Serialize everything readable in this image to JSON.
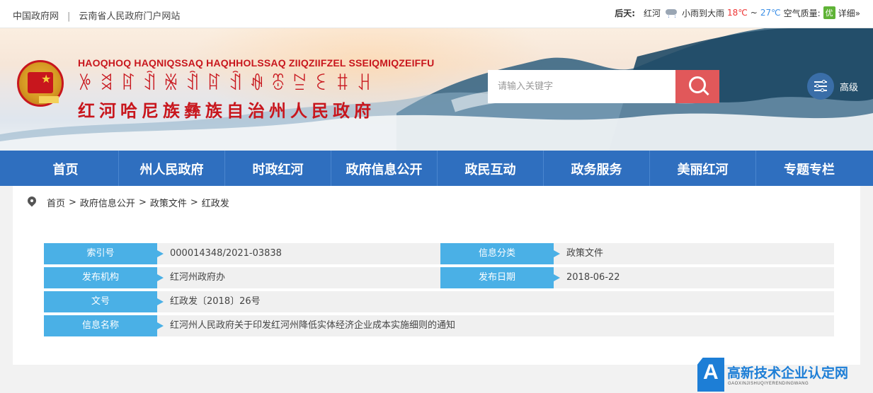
{
  "topbar": {
    "link1": "中国政府网",
    "separator": "|",
    "link2": "云南省人民政府门户网站",
    "weather": {
      "day_label": "后天:",
      "city": "红河",
      "icon": "rain-cloud-icon",
      "condition": "小雨到大雨",
      "temp_high": "18℃",
      "range_sep": "~",
      "temp_low": "27℃",
      "aq_label": "空气质量:",
      "aq_value": "优",
      "details_link": "详细»"
    }
  },
  "header": {
    "title_romanized": "HAOQHOQ HAQNIQSSAQ HAQHHOLSSAQ ZIIQZIIFZEL SSEIQMIQZEIFFU",
    "title_yi": "ꉼꈬꍏꀉꍐꀉꍏꀉꊿꁨꊂꏂꐚꃅ",
    "title_chinese": "红河哈尼族彝族自治州人民政府",
    "emblem_icon": "national-emblem-icon",
    "search_placeholder": "请输入关键字",
    "search_icon": "search-icon",
    "advanced_label": "高级",
    "advanced_icon": "sliders-icon"
  },
  "nav": {
    "items": [
      "首页",
      "州人民政府",
      "时政红河",
      "政府信息公开",
      "政民互动",
      "政务服务",
      "美丽红河",
      "专题专栏"
    ]
  },
  "breadcrumb": {
    "icon": "location-pin-icon",
    "items": [
      "首页",
      "政府信息公开",
      "政策文件",
      "红政发"
    ],
    "separator": ">"
  },
  "meta": {
    "index_label": "索引号",
    "index_value": "000014348/2021-03838",
    "category_label": "信息分类",
    "category_value": "政策文件",
    "publisher_label": "发布机构",
    "publisher_value": "红河州政府办",
    "date_label": "发布日期",
    "date_value": "2018-06-22",
    "docno_label": "文号",
    "docno_value": "红政发〔2018〕26号",
    "name_label": "信息名称",
    "name_value": "红河州人民政府关于印发红河州降低实体经济企业成本实施细则的通知"
  },
  "watermark": {
    "logo_letter": "A",
    "title": "高新技术企业认定网",
    "subtitle": "GAOXINJISHUQIYERENDINGWANG"
  },
  "colors": {
    "nav_blue": "#2f6fbf",
    "label_blue": "#4ab0e6",
    "title_red": "#c8161d",
    "search_button": "#e1585a"
  }
}
